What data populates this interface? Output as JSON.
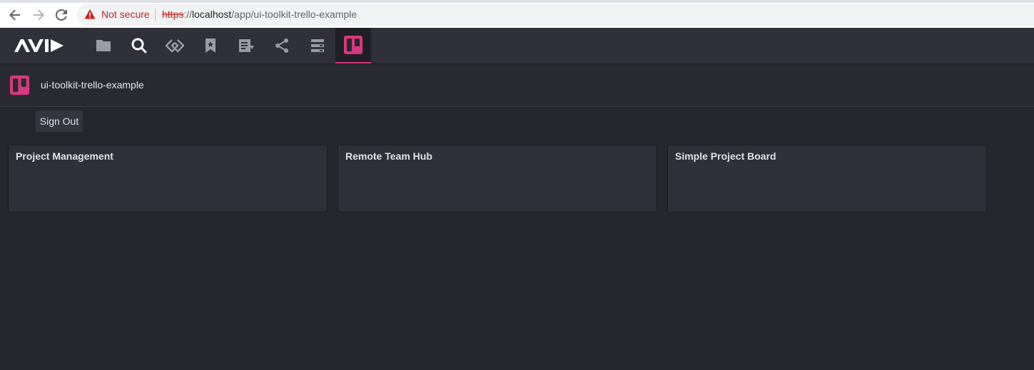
{
  "browser": {
    "security_label": "Not secure",
    "url_scheme": "https",
    "url_sep": "://",
    "url_host": "localhost",
    "url_path": "/app/ui-toolkit-trello-example"
  },
  "toolbar": {
    "logo_text": "AVID",
    "accent_color": "#d8387f",
    "icons": [
      "folder-icon",
      "search-icon",
      "link-icon",
      "bookmark-icon",
      "playlist-icon",
      "share-icon",
      "storage-icon",
      "trello-icon"
    ],
    "active_icon": "trello-icon"
  },
  "app": {
    "title": "ui-toolkit-trello-example",
    "sign_out_label": "Sign Out"
  },
  "boards": [
    {
      "title": "Project Management"
    },
    {
      "title": "Remote Team Hub"
    },
    {
      "title": "Simple Project Board"
    }
  ]
}
